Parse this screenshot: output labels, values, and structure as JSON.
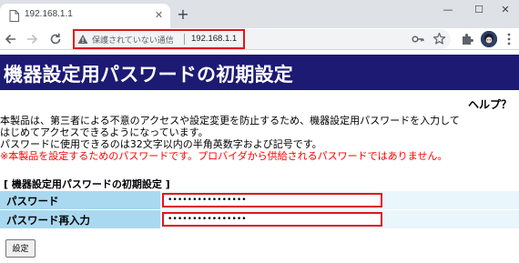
{
  "browser": {
    "tab_title": "192.168.1.1",
    "tab_close_glyph": "✕",
    "new_tab_glyph": "+",
    "window_controls": {
      "minimize": "—",
      "maximize": "☐",
      "close": "✕"
    },
    "security_text": "保護されていない通信",
    "url": "192.168.1.1",
    "accent_highlight": "#e0161e"
  },
  "page": {
    "title": "機器設定用パスワードの初期設定",
    "help": "ヘルプ？",
    "description": [
      "本製品は、第三者による不意のアクセスや設定変更を防止するため、機器設定用パスワードを入力して",
      "はじめてアクセスできるようになっています。",
      "パスワードに使用できるのは32文字以内の半角英数字および記号です。"
    ],
    "note": "※本製品を設定するためのパスワードです。プロバイダから供給されるパスワードではありません。",
    "section_title": "[ 機器設定用パスワードの初期設定 ]",
    "fields": [
      {
        "label": "パスワード",
        "value": "••••••••••••••••"
      },
      {
        "label": "パスワード再入力",
        "value": "••••••••••••••••"
      }
    ],
    "submit_label": "設定",
    "colors": {
      "header_bg": "#1c1a73",
      "label_bg": "#a9d9f0",
      "field_bg": "#e9f6fb",
      "note": "#ff0000"
    }
  }
}
